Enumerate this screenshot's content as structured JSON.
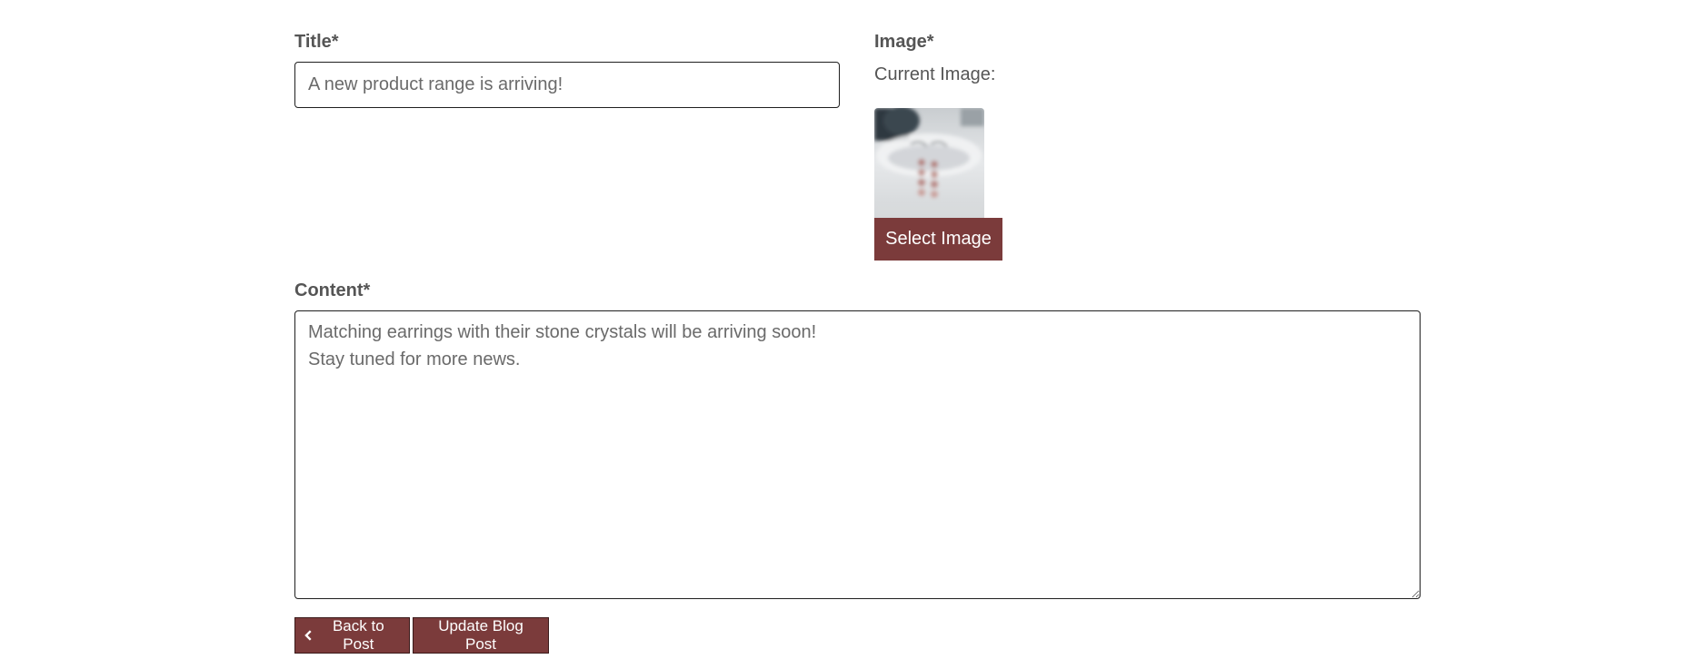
{
  "form": {
    "title_label": "Title*",
    "title_value": "A new product range is arriving!",
    "image_label": "Image*",
    "current_image_label": "Current Image:",
    "select_image_label": "Select Image",
    "content_label": "Content*",
    "content_value": "Matching earrings with their stone crystals will be arriving soon!\nStay tuned for more news."
  },
  "actions": {
    "back_label": "Back to Post",
    "back_icon": "chevron-left-icon",
    "update_label": "Update Blog Post"
  },
  "colors": {
    "button": "#7b3b3b",
    "label": "#555555",
    "input_border": "#1f1f1f"
  }
}
